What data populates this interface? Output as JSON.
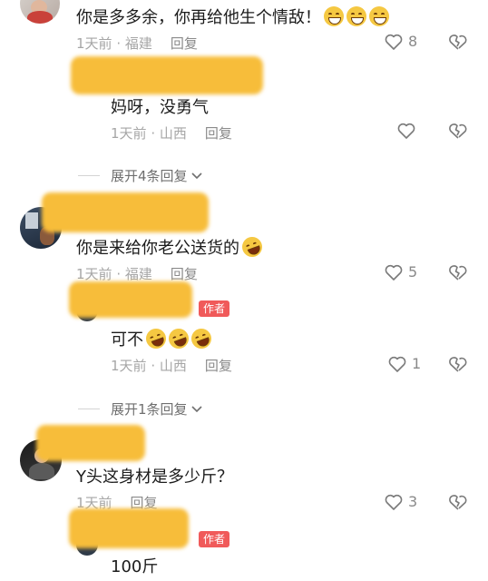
{
  "comments": [
    {
      "text": "你是多多余，你再给他生个情敌！",
      "time": "1天前",
      "location": "福建",
      "reply_label": "回复",
      "likes": "8",
      "emoji": "grinning-face"
    },
    {
      "text": "你是来给你老公送货的",
      "time": "1天前",
      "location": "福建",
      "reply_label": "回复",
      "likes": "5",
      "emoji": "rolling-laughing-face"
    },
    {
      "text": "Y头这身材是多少斤？",
      "time": "1天前",
      "location": "",
      "reply_label": "回复",
      "likes": "3"
    }
  ],
  "replies": [
    {
      "text": "妈呀，没勇气",
      "time": "1天前",
      "location": "山西",
      "reply_label": "回复",
      "likes": ""
    },
    {
      "text": "可不",
      "time": "1天前",
      "location": "山西",
      "reply_label": "回复",
      "likes": "1",
      "author_badge": "作者",
      "emoji": "rolling-laughing-face"
    },
    {
      "text": "100斤",
      "author_badge": "作者"
    }
  ],
  "expand": [
    {
      "label": "展开4条回复"
    },
    {
      "label": "展开1条回复"
    }
  ],
  "colors": {
    "redaction": "#f7bd3a",
    "author_badge": "#f05a5a",
    "meta_text": "#a6a6a6"
  }
}
